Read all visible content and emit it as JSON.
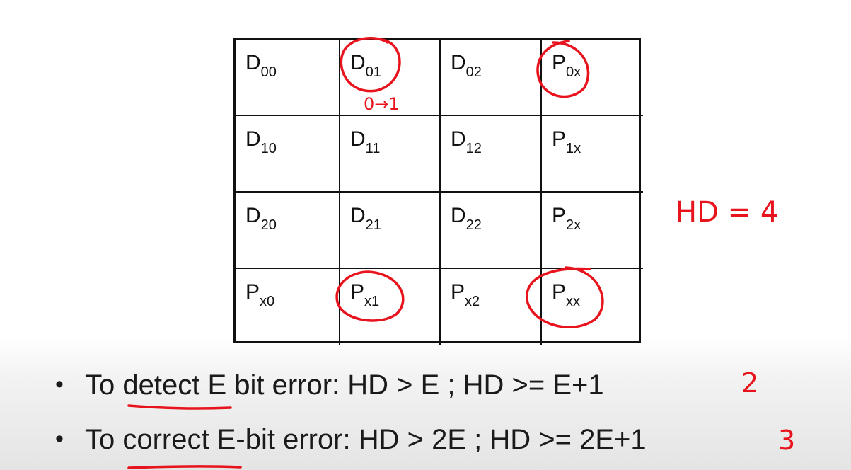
{
  "grid": {
    "rows": [
      [
        {
          "main": "D",
          "sub": "00"
        },
        {
          "main": "D",
          "sub": "01"
        },
        {
          "main": "D",
          "sub": "02"
        },
        {
          "main": "P",
          "sub": "0x"
        }
      ],
      [
        {
          "main": "D",
          "sub": "10"
        },
        {
          "main": "D",
          "sub": "11"
        },
        {
          "main": "D",
          "sub": "12"
        },
        {
          "main": "P",
          "sub": "1x"
        }
      ],
      [
        {
          "main": "D",
          "sub": "20"
        },
        {
          "main": "D",
          "sub": "21"
        },
        {
          "main": "D",
          "sub": "22"
        },
        {
          "main": "P",
          "sub": "2x"
        }
      ],
      [
        {
          "main": "P",
          "sub": "x0"
        },
        {
          "main": "P",
          "sub": "x1"
        },
        {
          "main": "P",
          "sub": "x2"
        },
        {
          "main": "P",
          "sub": "xx"
        }
      ]
    ]
  },
  "annotations": {
    "flip": "0→1",
    "hd": "HD = 4",
    "detect_value": "2",
    "correct_value": "3",
    "ink_color": "#e8141d"
  },
  "bullets": [
    {
      "marker": "•",
      "text": "To detect E bit error: HD > E ; HD >= E+1"
    },
    {
      "marker": "•",
      "text": "To correct E-bit error: HD > 2E ; HD >= 2E+1"
    }
  ]
}
